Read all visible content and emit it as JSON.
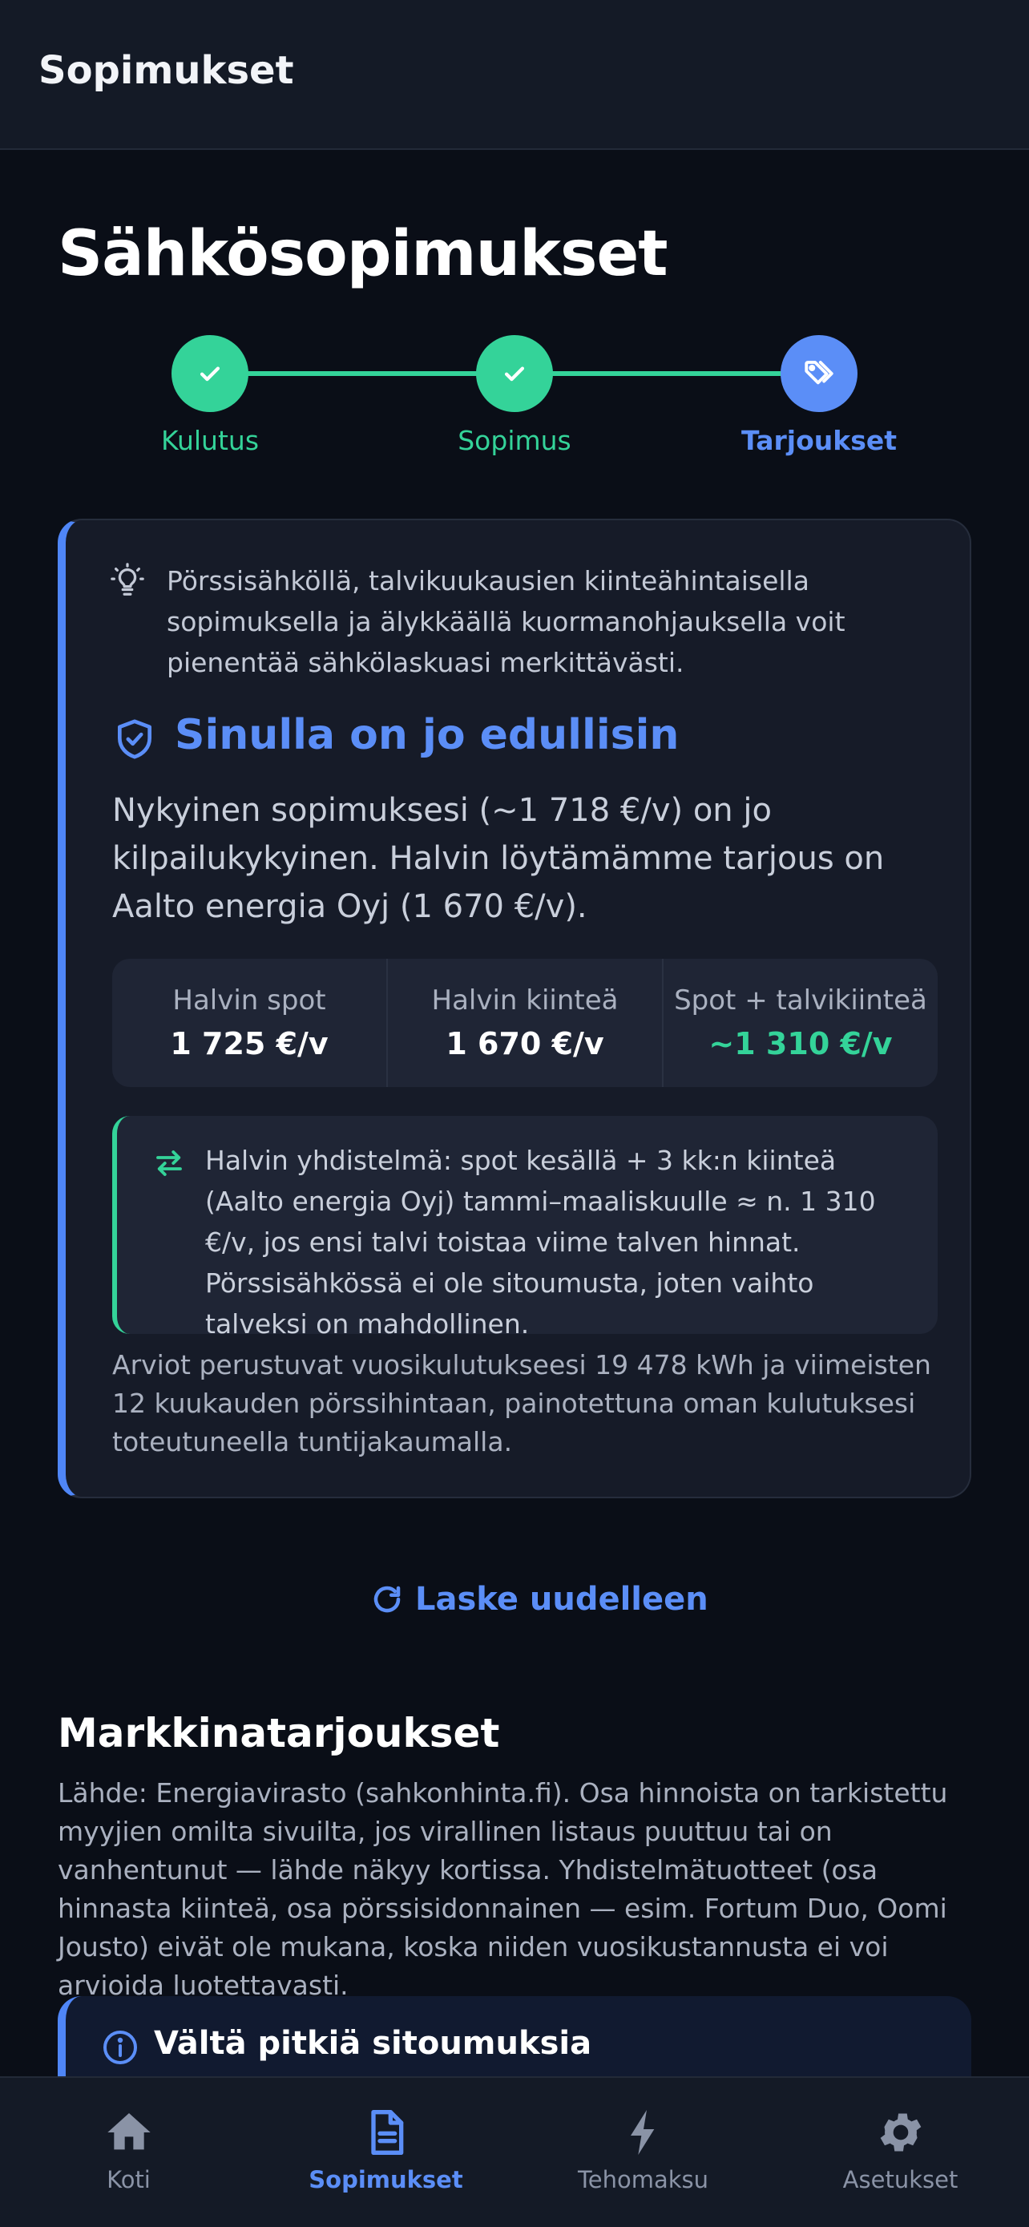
{
  "appbar": {
    "title": "Sopimukset"
  },
  "page": {
    "title": "Sähkösopimukset"
  },
  "stepper": {
    "steps": [
      {
        "label": "Kulutus",
        "state": "done"
      },
      {
        "label": "Sopimus",
        "state": "done"
      },
      {
        "label": "Tarjoukset",
        "state": "active"
      }
    ]
  },
  "card": {
    "tip": "Pörssisähköllä, talvikuukausien kiinteähintaisella sopimuksella ja älykkäällä kuormanohjauksella voit pienentää sähkölaskuasi merkittävästi.",
    "result_title": "Sinulla on jo edullisin",
    "result_desc": "Nykyinen sopimuksesi (~1 718 €/v) on jo kilpailukykyinen. Halvin löytämämme tarjous on Aalto energia Oyj (1 670 €/v).",
    "stats": [
      {
        "label": "Halvin spot",
        "value": "1 725 €/v"
      },
      {
        "label": "Halvin kiinteä",
        "value": "1 670 €/v"
      },
      {
        "label": "Spot + talvikiinteä",
        "value": "~1 310 €/v"
      }
    ],
    "combo": "Halvin yhdistelmä: spot kesällä + 3 kk:n kiinteä (Aalto energia Oyj) tammi–maaliskuulle ≈ n. 1 310 €/v, jos ensi talvi toistaa viime talven hinnat. Pörssisähkössä ei ole sitoumusta, joten vaihto talveksi on mahdollinen.",
    "footnote": "Arviot perustuvat vuosikulutukseesi 19 478 kWh ja viimeisten 12 kuukauden pörssihintaan, painotettuna oman kulutuksesi toteutuneella tuntijakaumalla."
  },
  "recalc": {
    "label": "Laske uudelleen"
  },
  "market": {
    "title": "Markkinatarjoukset",
    "desc": "Lähde: Energiavirasto (sahkonhinta.fi). Osa hinnoista on tarkistettu myyjien omilta sivuilta, jos virallinen listaus puuttuu tai on vanhentunut — lähde näkyy kortissa. Yhdistelmätuotteet (osa hinnasta kiinteä, osa pörssisidonnainen — esim. Fortum Duo, Oomi Jousto) eivät ole mukana, koska niiden vuosikustannusta ei voi arvioida luotettavasti."
  },
  "warning": {
    "title": "Vältä pitkiä sitoumuksia"
  },
  "nav": {
    "items": [
      {
        "label": "Koti",
        "icon": "home-icon"
      },
      {
        "label": "Sopimukset",
        "icon": "document-icon"
      },
      {
        "label": "Tehomaksu",
        "icon": "lightning-icon"
      },
      {
        "label": "Asetukset",
        "icon": "gear-icon"
      }
    ],
    "active": "Sopimukset"
  },
  "colors": {
    "accent": "#5b8ef7",
    "success": "#34d399",
    "background": "#0a0e17",
    "surface": "#161b28"
  }
}
